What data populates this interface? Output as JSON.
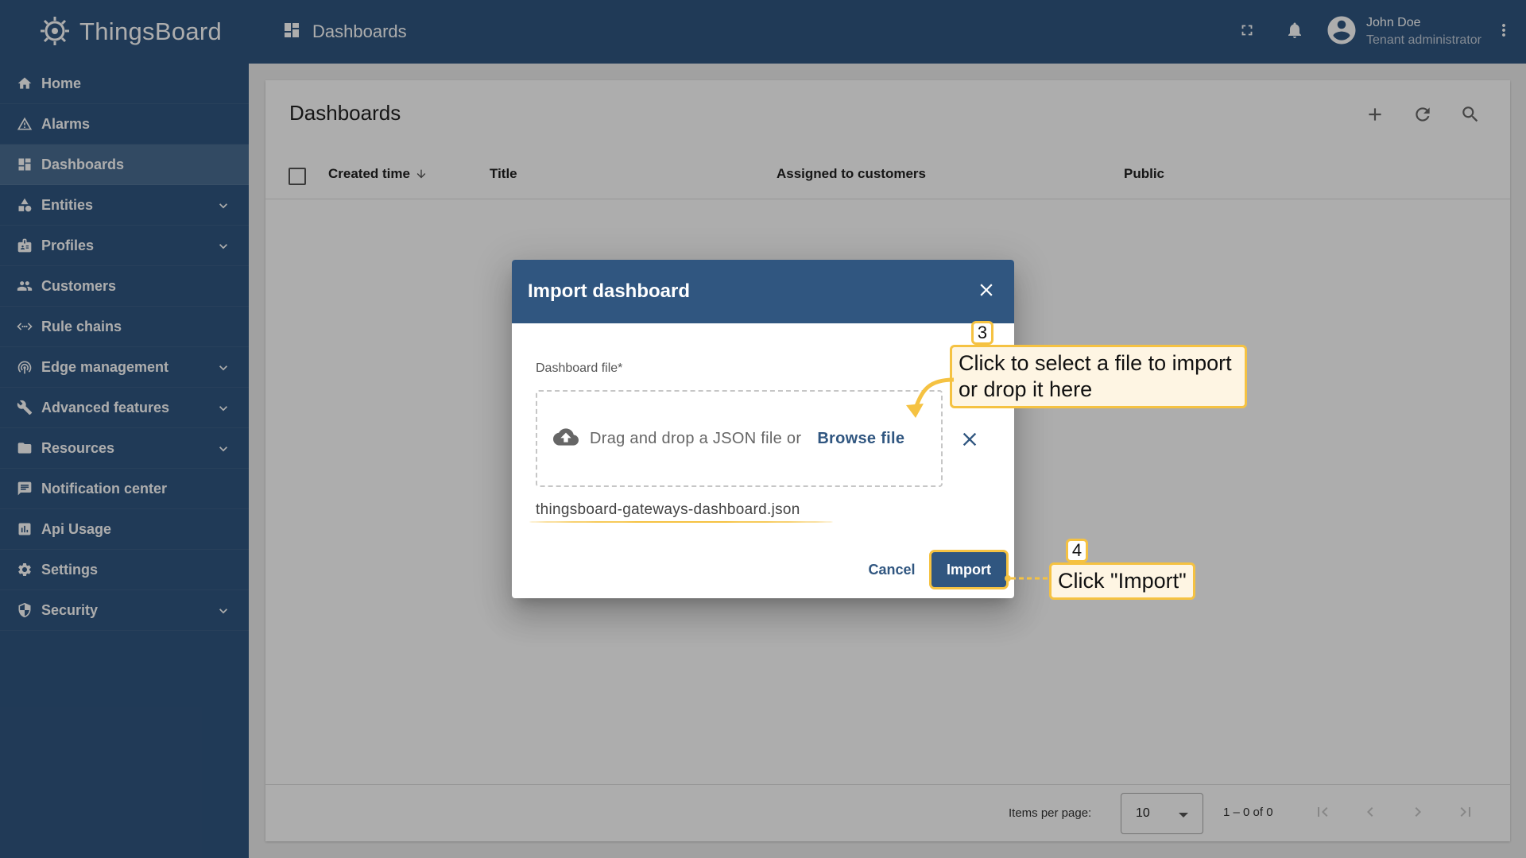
{
  "app": {
    "name": "ThingsBoard"
  },
  "topbar": {
    "section_title": "Dashboards"
  },
  "user": {
    "name": "John Doe",
    "role": "Tenant administrator"
  },
  "sidebar": {
    "items": [
      {
        "label": "Home",
        "icon": "home-icon",
        "expandable": false,
        "active": false
      },
      {
        "label": "Alarms",
        "icon": "alarm-icon",
        "expandable": false,
        "active": false
      },
      {
        "label": "Dashboards",
        "icon": "dashboard-icon",
        "expandable": false,
        "active": true
      },
      {
        "label": "Entities",
        "icon": "entities-icon",
        "expandable": true,
        "active": false
      },
      {
        "label": "Profiles",
        "icon": "profiles-icon",
        "expandable": true,
        "active": false
      },
      {
        "label": "Customers",
        "icon": "customers-icon",
        "expandable": false,
        "active": false
      },
      {
        "label": "Rule chains",
        "icon": "rule-chains-icon",
        "expandable": false,
        "active": false
      },
      {
        "label": "Edge management",
        "icon": "edge-icon",
        "expandable": true,
        "active": false
      },
      {
        "label": "Advanced features",
        "icon": "tools-icon",
        "expandable": true,
        "active": false
      },
      {
        "label": "Resources",
        "icon": "folder-icon",
        "expandable": true,
        "active": false
      },
      {
        "label": "Notification center",
        "icon": "notification-center-icon",
        "expandable": false,
        "active": false
      },
      {
        "label": "Api Usage",
        "icon": "api-usage-icon",
        "expandable": false,
        "active": false
      },
      {
        "label": "Settings",
        "icon": "gear-icon",
        "expandable": false,
        "active": false
      },
      {
        "label": "Security",
        "icon": "shield-icon",
        "expandable": true,
        "active": false
      }
    ]
  },
  "main": {
    "title": "Dashboards",
    "columns": [
      "Created time",
      "Title",
      "Assigned to customers",
      "Public"
    ],
    "footer": {
      "items_per_page_label": "Items per page:",
      "items_per_page_value": "10",
      "range_label": "1 – 0 of 0"
    }
  },
  "dialog": {
    "title": "Import dashboard",
    "field_label": "Dashboard file*",
    "drop_text": "Drag and drop a JSON file or",
    "browse_label": "Browse file",
    "file_name": "thingsboard-gateways-dashboard.json",
    "cancel_label": "Cancel",
    "import_label": "Import"
  },
  "annotations": [
    {
      "number": "3",
      "text_line1": "Click to select a file to import",
      "text_line2": "or drop it here"
    },
    {
      "number": "4",
      "text": "Click \"Import\""
    }
  ],
  "colors": {
    "primary": "#305680",
    "accent": "#f5c242",
    "callout_bg": "#fef5e3"
  }
}
